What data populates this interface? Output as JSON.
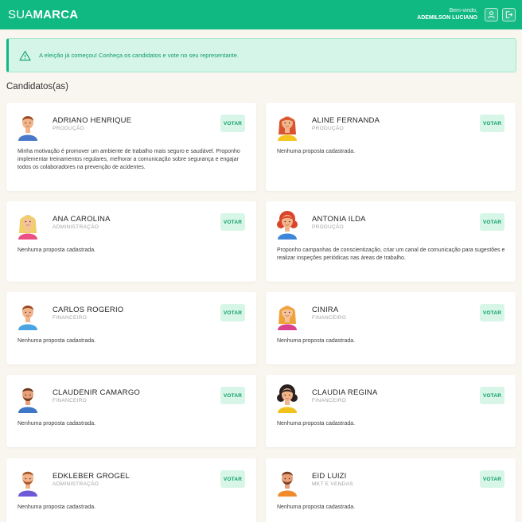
{
  "header": {
    "brand_light": "SUA",
    "brand_bold": "MARCA",
    "greeting": "Bem-vindo,",
    "user_name": "ADEMILSON LUCIANO",
    "icons": [
      "user-icon",
      "logout-icon"
    ]
  },
  "alert": {
    "icon": "warning-icon",
    "message": "A eleição já começou! Conheça os candidatos e vote no seu representante."
  },
  "section": {
    "title": "Candidatos(as)"
  },
  "vote_label": "VOTAR",
  "candidates": [
    {
      "name": "ADRIANO HENRIQUE",
      "department": "PRODUÇÃO",
      "proposal": "Minha motivação é promover um ambiente de trabalho mais seguro e saudável. Proponho implementar treinamentos regulares, melhorar a comunicação sobre segurança e engajar todos os colaboradores na prevenção de acidentes.",
      "avatar": {
        "skin": "#f2b48a",
        "hair": "#9a4a23",
        "shirt": "#4a78c8",
        "style": "short"
      }
    },
    {
      "name": "ALINE FERNANDA",
      "department": "PRODUÇÃO",
      "proposal": "Nenhuma proposta cadastrada.",
      "avatar": {
        "skin": "#f2b48a",
        "hair": "#d9542e",
        "shirt": "#f5c41e",
        "style": "long"
      }
    },
    {
      "name": "ANA CAROLINA",
      "department": "ADMINISTRAÇÃO",
      "proposal": "Nenhuma proposta cadastrada.",
      "avatar": {
        "skin": "#f5c29a",
        "hair": "#f0cf6a",
        "shirt": "#ec4f82",
        "style": "long"
      }
    },
    {
      "name": "ANTONIA ILDA",
      "department": "PRODUÇÃO",
      "proposal": "Proponho campanhas de conscientização, criar um canal de comunicação para sugestões e realizar inspeções periódicas nas áreas de trabalho.",
      "avatar": {
        "skin": "#f2b48a",
        "hair": "#d9442a",
        "shirt": "#3e86d8",
        "style": "curly"
      }
    },
    {
      "name": "CARLOS ROGERIO",
      "department": "FINANCEIRO",
      "proposal": "Nenhuma proposta cadastrada.",
      "avatar": {
        "skin": "#f2b48a",
        "hair": "#9a4a23",
        "shirt": "#4aa5e0",
        "style": "short"
      }
    },
    {
      "name": "CINIRA",
      "department": "FINANCEIRO",
      "proposal": "Nenhuma proposta cadastrada.",
      "avatar": {
        "skin": "#f5c29a",
        "hair": "#f0a23a",
        "shirt": "#d9438e",
        "style": "long"
      }
    },
    {
      "name": "CLAUDENIR CAMARGO",
      "department": "FINANCEIRO",
      "proposal": "Nenhuma proposta cadastrada.",
      "avatar": {
        "skin": "#e8a07a",
        "hair": "#6a3a1e",
        "shirt": "#3e76c8",
        "style": "beard"
      }
    },
    {
      "name": "CLAUDIA REGINA",
      "department": "FINANCEIRO",
      "proposal": "Nenhuma proposta cadastrada.",
      "avatar": {
        "skin": "#f2b48a",
        "hair": "#2a2020",
        "shirt": "#f0c21e",
        "style": "curly"
      }
    },
    {
      "name": "EDKLEBER GROGEL",
      "department": "ADMINISTRAÇÃO",
      "proposal": "Nenhuma proposta cadastrada.",
      "avatar": {
        "skin": "#f2b48a",
        "hair": "#a55a2c",
        "shirt": "#6e5ad6",
        "style": "beard"
      }
    },
    {
      "name": "EID LUIZI",
      "department": "MKT E VENDAS",
      "proposal": "Nenhuma proposta cadastrada.",
      "avatar": {
        "skin": "#e8a07a",
        "hair": "#7a3e22",
        "shirt": "#f08a2a",
        "style": "beard"
      }
    }
  ]
}
